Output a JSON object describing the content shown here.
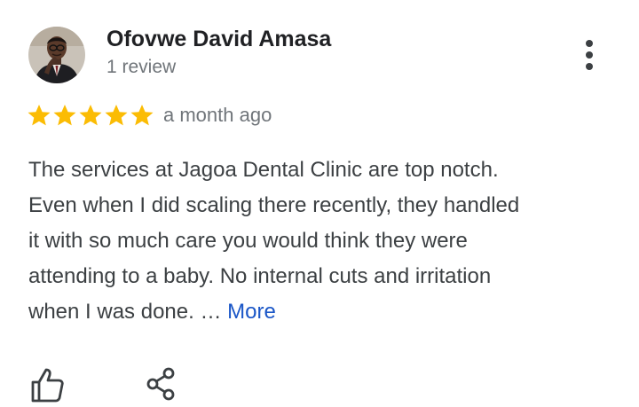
{
  "reviewer": {
    "name": "Ofovwe David Amasa",
    "review_count": "1 review"
  },
  "rating": {
    "stars": 5,
    "max_stars": 5,
    "star_color": "#fbbc04"
  },
  "review": {
    "date": "a month ago",
    "lines": [
      "The services at Jagoa Dental Clinic are top notch.",
      "Even when I did scaling there recently, they handled",
      "it with so much care you would think they were",
      "attending to a baby. No internal cuts and irritation",
      "when I was done. … "
    ],
    "more_label": "More"
  },
  "icons": {
    "menu": "more-vert-icon",
    "like": "thumbs-up-icon",
    "share": "share-icon"
  },
  "colors": {
    "link": "#1a56c7",
    "text": "#3c4043",
    "secondary": "#70757a"
  }
}
